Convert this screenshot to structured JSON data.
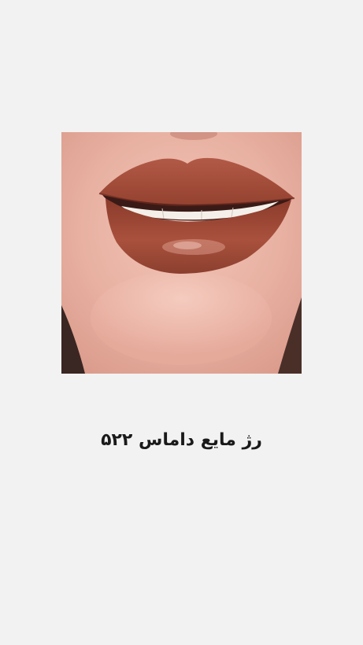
{
  "image": {
    "subject": "lips-photo"
  },
  "caption": {
    "text": "رژ مایع داماس ۵۲۲"
  }
}
